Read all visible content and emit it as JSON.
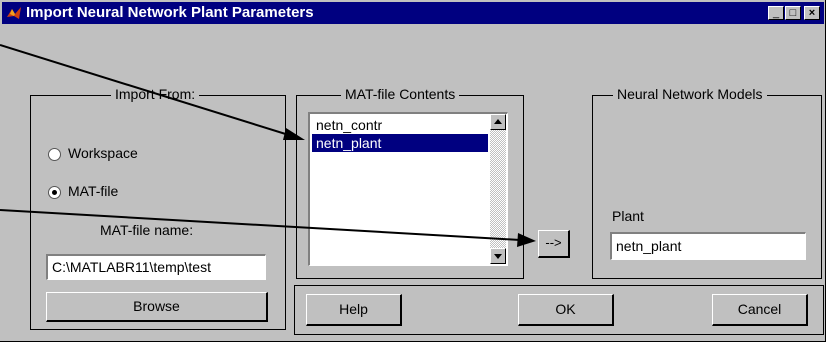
{
  "window": {
    "title": "Import Neural Network Plant Parameters"
  },
  "titlebar_buttons": {
    "minimize": "_",
    "maximize": "□",
    "close": "×"
  },
  "import_from": {
    "legend": "Import From:",
    "options": [
      "Workspace",
      "MAT-file"
    ],
    "selected": "MAT-file",
    "filename_label": "MAT-file name:",
    "filename_value": "C:\\MATLABR11\\temp\\test",
    "browse_label": "Browse"
  },
  "mat_contents": {
    "legend": "MAT-file Contents",
    "items": [
      "netn_contr",
      "netn_plant"
    ],
    "selected_index": 1
  },
  "transfer_button": "-->",
  "nn_models": {
    "legend": "Neural Network Models",
    "plant_label": "Plant",
    "plant_value": "netn_plant"
  },
  "footer": {
    "help": "Help",
    "ok": "OK",
    "cancel": "Cancel"
  },
  "colors": {
    "titlebar": "#000080",
    "face": "#c0c0c0",
    "selection": "#000080"
  }
}
